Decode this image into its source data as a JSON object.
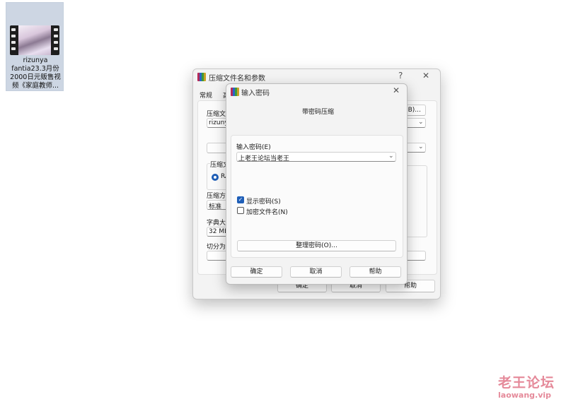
{
  "desktop": {
    "file_caption_lines": [
      "rizunya",
      "fantia23.3月份",
      "2000日元贩售视",
      "频《家庭教师..."
    ]
  },
  "back_dialog": {
    "title": "压缩文件名和参数",
    "help_glyph": "?",
    "close_glyph": "✕",
    "tab_general": "常规",
    "tab_advanced_partial": "高",
    "archive_name_label_partial": "压缩文",
    "archive_name_value_partial": "rizunya",
    "browse_button_partial": "(B)...",
    "format_group_label_partial": "压缩文",
    "format_rar_partial": "RA",
    "method_label_partial": "压缩方",
    "method_value_partial": "标准",
    "dict_label_partial": "字典大",
    "dict_value_partial": "32 MB",
    "split_label_partial": "切分为",
    "ok": "确定",
    "cancel": "取消",
    "help": "帮助"
  },
  "password_dialog": {
    "title": "输入密码",
    "heading": "带密码压缩",
    "password_label": "输入密码(E)",
    "password_value": "上老王论坛当老王",
    "show_password_label": "显示密码(S)",
    "show_password_checked": true,
    "encrypt_names_label": "加密文件名(N)",
    "encrypt_names_checked": false,
    "organize_button": "整理密码(O)...",
    "ok": "确定",
    "cancel": "取消",
    "help": "帮助",
    "close_glyph": "✕"
  },
  "watermark": {
    "line1": "老王论坛",
    "line2": "laowang.vip"
  }
}
